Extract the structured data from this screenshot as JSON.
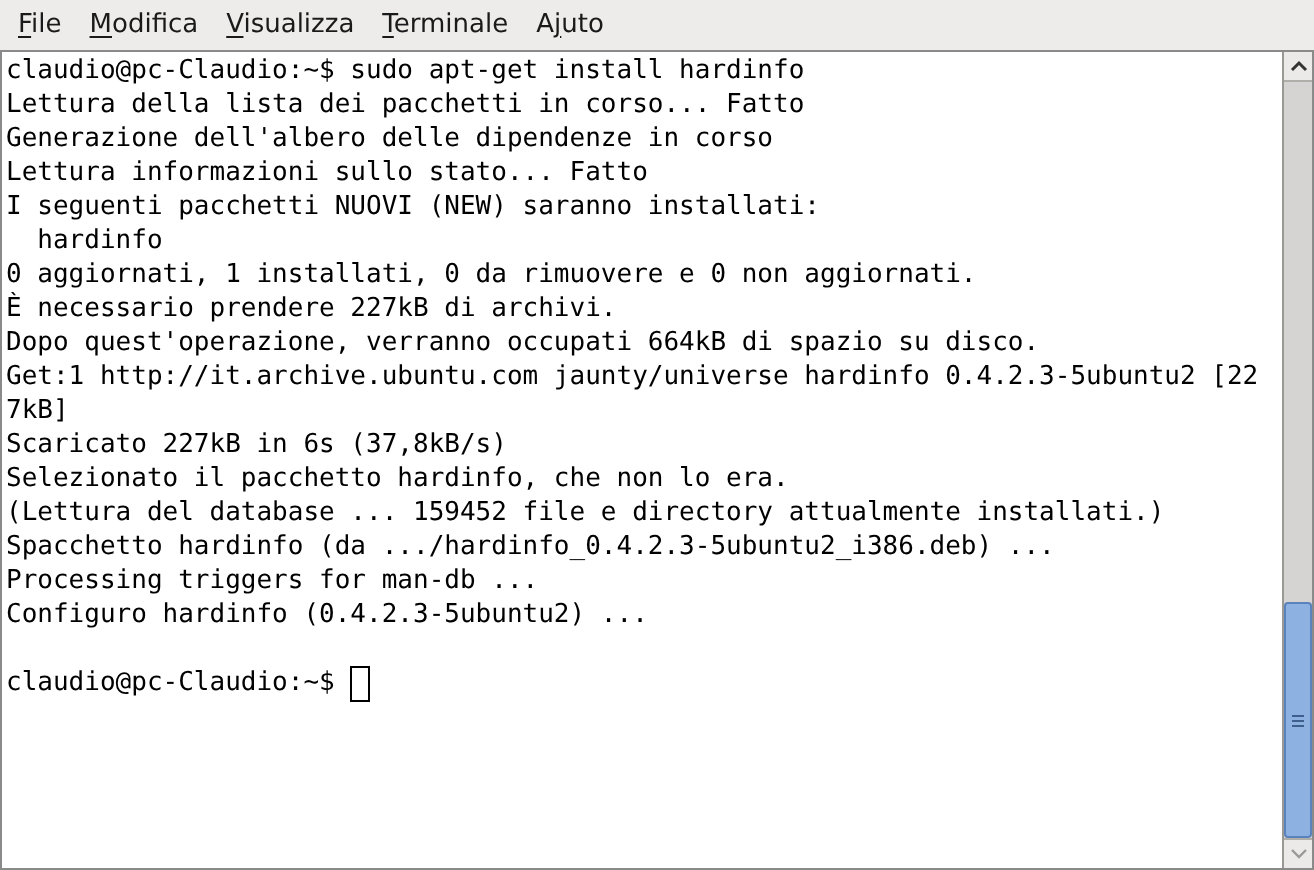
{
  "menu": [
    {
      "access_key": "F",
      "rest": "ile"
    },
    {
      "access_key": "M",
      "rest": "odifica"
    },
    {
      "access_key": "V",
      "rest": "isualizza"
    },
    {
      "access_key": "T",
      "rest": "erminale"
    },
    {
      "lead": "A",
      "access_key": "j",
      "rest": "uto"
    }
  ],
  "terminal": {
    "lines": [
      "claudio@pc-Claudio:~$ sudo apt-get install hardinfo",
      "Lettura della lista dei pacchetti in corso... Fatto",
      "Generazione dell'albero delle dipendenze in corso",
      "Lettura informazioni sullo stato... Fatto",
      "I seguenti pacchetti NUOVI (NEW) saranno installati:",
      "  hardinfo",
      "0 aggiornati, 1 installati, 0 da rimuovere e 0 non aggiornati.",
      "È necessario prendere 227kB di archivi.",
      "Dopo quest'operazione, verranno occupati 664kB di spazio su disco.",
      "Get:1 http://it.archive.ubuntu.com jaunty/universe hardinfo 0.4.2.3-5ubuntu2 [22",
      "7kB]",
      "Scaricato 227kB in 6s (37,8kB/s)",
      "Selezionato il pacchetto hardinfo, che non lo era.",
      "(Lettura del database ... 159452 file e directory attualmente installati.)",
      "Spacchetto hardinfo (da .../hardinfo_0.4.2.3-5ubuntu2_i386.deb) ...",
      "Processing triggers for man-db ...",
      "Configuro hardinfo (0.4.2.3-5ubuntu2) ..."
    ],
    "prompt": "claudio@pc-Claudio:~$"
  }
}
